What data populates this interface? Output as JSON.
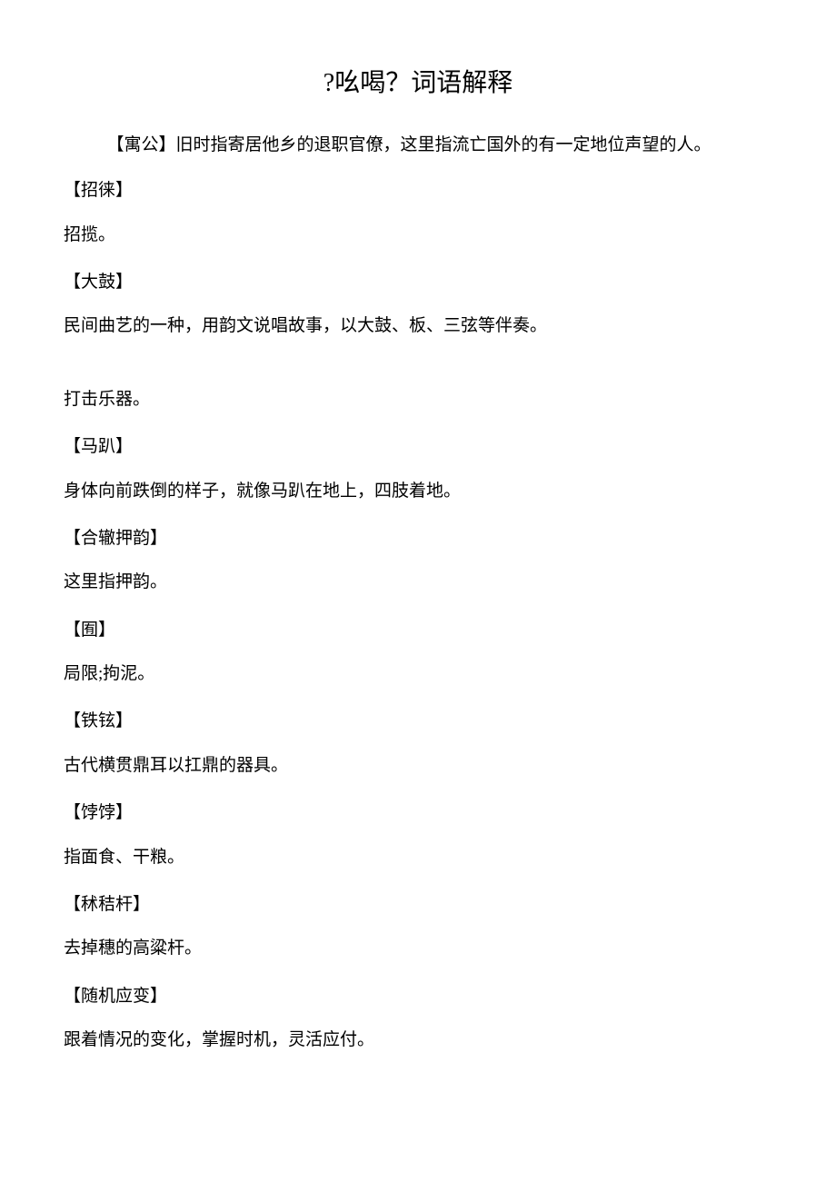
{
  "title": "?吆喝？词语解释",
  "first_entry": "【寓公】旧时指寄居他乡的退职官僚，这里指流亡国外的有一定地位声望的人。",
  "entries": [
    {
      "term": "【招徕】",
      "definition": "招揽。"
    },
    {
      "term": "【大鼓】",
      "definition": "民间曲艺的一种，用韵文说唱故事，以大鼓、板、三弦等伴奏。"
    }
  ],
  "extra_definition": "打击乐器。",
  "entries2": [
    {
      "term": "【马趴】",
      "definition": "身体向前跌倒的样子，就像马趴在地上，四肢着地。"
    },
    {
      "term": "【合辙押韵】",
      "definition": "这里指押韵。"
    },
    {
      "term": "【囿】",
      "definition": "局限;拘泥。"
    },
    {
      "term": "【铁铉】",
      "definition": "古代横贯鼎耳以扛鼎的器具。"
    },
    {
      "term": "【饽饽】",
      "definition": "指面食、干粮。"
    },
    {
      "term": "【秫秸杆】",
      "definition": "去掉穗的高粱杆。"
    },
    {
      "term": "【随机应变】",
      "definition": "跟着情况的变化，掌握时机，灵活应付。"
    }
  ]
}
